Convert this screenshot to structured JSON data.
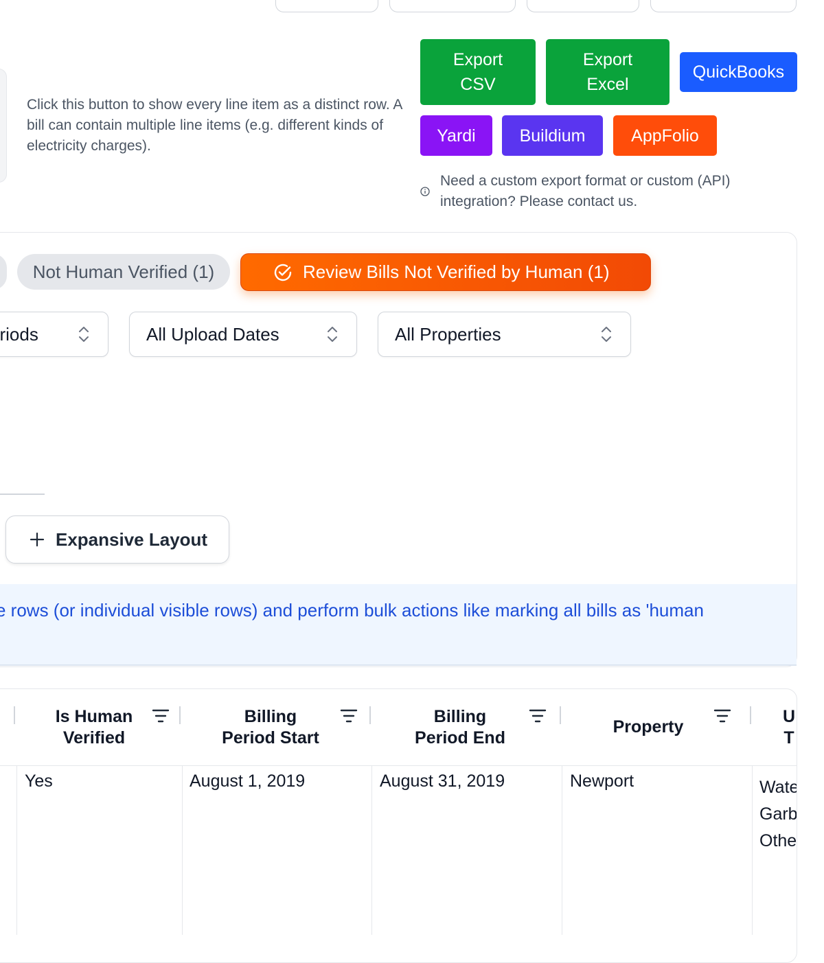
{
  "export": {
    "csv_label": "Export\nCSV",
    "excel_label": "Export\nExcel",
    "quickbooks_label": "QuickBooks",
    "yardi_label": "Yardi",
    "buildium_label": "Buildium",
    "appfolio_label": "AppFolio",
    "custom_note": "Need a custom export format or custom (API) integration? Please contact us."
  },
  "line_item_help": "Click this button to show every line item as a distinct row. A bill can contain multiple line items (e.g. different kinds of electricity charges).",
  "filters": {
    "not_verified_pill": "Not Human Verified (1)",
    "review_button": "Review Bills Not Verified by Human (1)",
    "periods_select": "eriods",
    "upload_dates_select": "All Upload Dates",
    "properties_select": "All Properties"
  },
  "layout_button": "Expansive Layout",
  "bulk_info": "e rows (or individual visible rows) and perform bulk actions like marking all bills as 'human",
  "table": {
    "headers": [
      "Is Human\nVerified",
      "Billing\nPeriod Start",
      "Billing\nPeriod End",
      "Property",
      "U\nT"
    ],
    "row": {
      "is_human_verified": "Yes",
      "billing_period_start": "August 1, 2019",
      "billing_period_end": "August 31, 2019",
      "property": "Newport",
      "utility_types": [
        "Wate",
        "Garb",
        "Othe"
      ]
    }
  },
  "colors": {
    "export_green": "#0aa33b",
    "quickbooks_blue": "#1a5cff",
    "yardi_purple": "#8a14f5",
    "buildium_indigo": "#5a35f0",
    "appfolio_orange": "#ff4d0a",
    "review_orange": "#ff6a00",
    "info_blue": "#1d4ed8"
  },
  "icons": [
    "info-circle-icon",
    "check-circle-icon",
    "chevron-up-down-icon",
    "plus-icon",
    "filter-icon"
  ]
}
